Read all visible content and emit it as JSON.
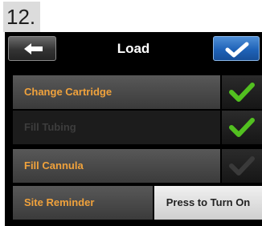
{
  "step": "12.",
  "header": {
    "title": "Load"
  },
  "icons": {
    "back": "left-arrow-icon",
    "ok": "checkmark-icon"
  },
  "colors": {
    "accent_orange": "#f0a23c",
    "check_green": "#52c020",
    "ok_blue": "#1f63b8"
  },
  "rows": [
    {
      "label": "Change Cartridge",
      "status": "complete"
    },
    {
      "label": "Fill Tubing",
      "status": "complete"
    },
    {
      "label": "Fill Cannula",
      "status": "incomplete"
    }
  ],
  "site_reminder": {
    "label": "Site Reminder",
    "button": "Press to Turn On"
  }
}
